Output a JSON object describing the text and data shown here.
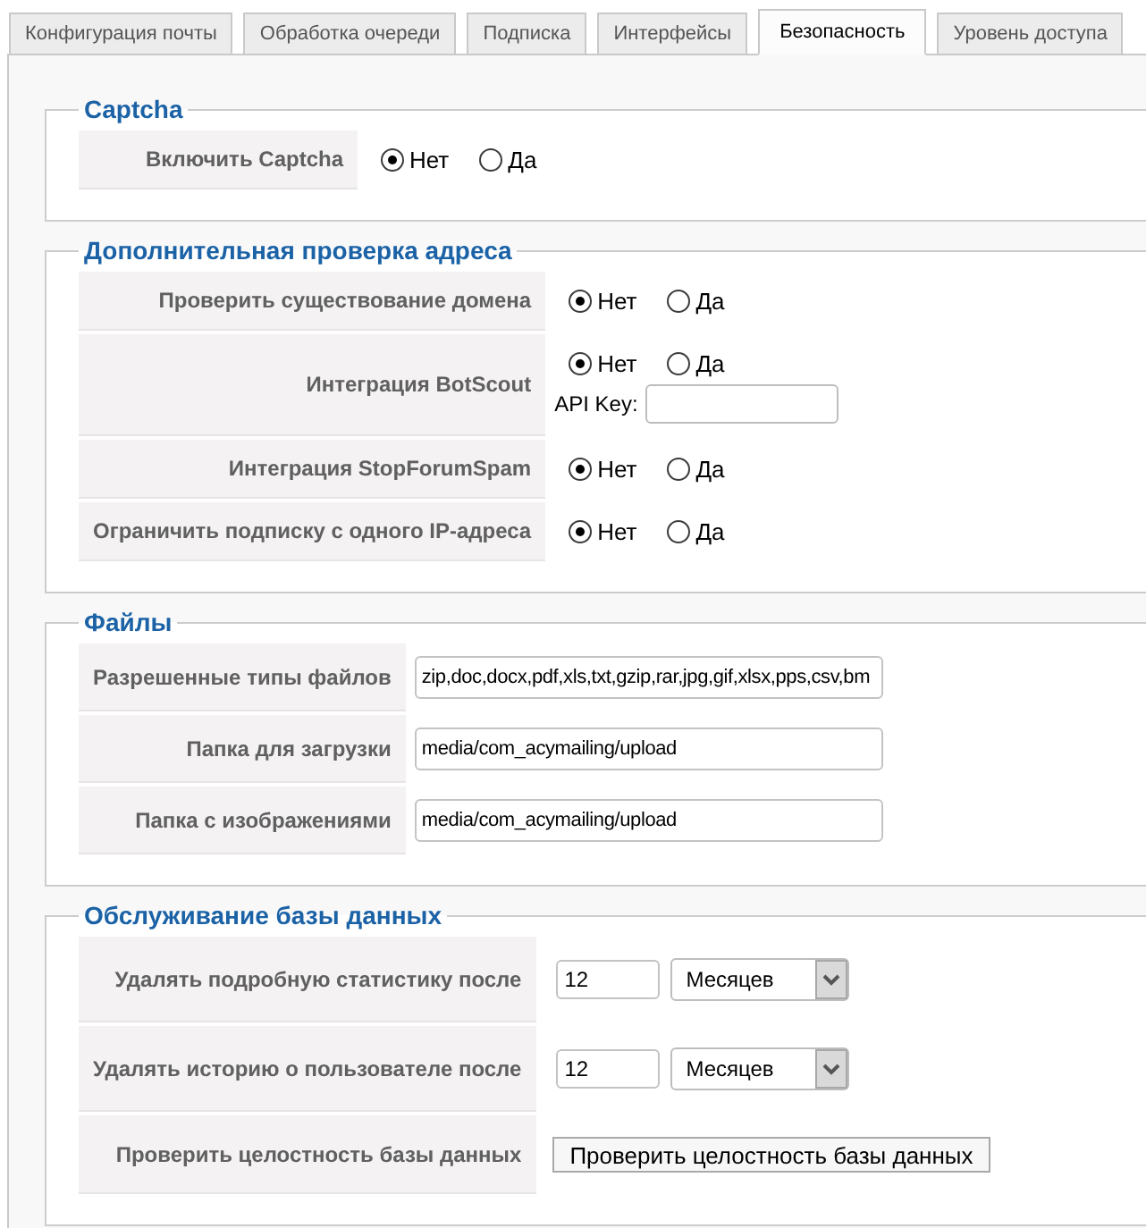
{
  "tabs": [
    {
      "label": "Конфигурация почты",
      "selected": false
    },
    {
      "label": "Обработка очереди",
      "selected": false
    },
    {
      "label": "Подписка",
      "selected": false
    },
    {
      "label": "Интерфейсы",
      "selected": false
    },
    {
      "label": "Безопасность",
      "selected": true
    },
    {
      "label": "Уровень доступа",
      "selected": false
    }
  ],
  "sections": [
    {
      "legend": "Captcha",
      "rows": [
        {
          "label": "Включить Captcha",
          "controls": [
            {
              "kind": "radio",
              "options": [
                {
                  "label": "Нет",
                  "selected": true
                },
                {
                  "label": "Да",
                  "selected": false
                }
              ]
            }
          ]
        }
      ]
    },
    {
      "legend": "Дополнительная проверка адреса",
      "rows": [
        {
          "label": "Проверить существование домена",
          "controls": [
            {
              "kind": "radio",
              "options": [
                {
                  "label": "Нет",
                  "selected": true
                },
                {
                  "label": "Да",
                  "selected": false
                }
              ]
            }
          ]
        },
        {
          "label": "Интеграция BotScout",
          "controls": [
            {
              "kind": "radio",
              "options": [
                {
                  "label": "Нет",
                  "selected": true
                },
                {
                  "label": "Да",
                  "selected": false
                }
              ]
            },
            {
              "kind": "field",
              "label": "API Key:"
            }
          ]
        },
        {
          "label": "Интеграция StopForumSpam",
          "controls": [
            {
              "kind": "radio",
              "options": [
                {
                  "label": "Нет",
                  "selected": true
                },
                {
                  "label": "Да",
                  "selected": false
                }
              ]
            }
          ]
        },
        {
          "label": "Ограничить подписку с одного IP-адреса",
          "controls": [
            {
              "kind": "radio",
              "options": [
                {
                  "label": "Нет",
                  "selected": true
                },
                {
                  "label": "Да",
                  "selected": false
                }
              ]
            }
          ]
        }
      ]
    },
    {
      "legend": "Файлы",
      "rows": [
        {
          "label": "Разрешенные типы файлов",
          "controls": [
            {
              "kind": "text",
              "value": "zip,doc,docx,pdf,xls,txt,gzip,rar,jpg,gif,xlsx,pps,csv,bm"
            }
          ]
        },
        {
          "label": "Папка для загрузки",
          "controls": [
            {
              "kind": "text",
              "value": "media/com_acymailing/upload"
            }
          ]
        },
        {
          "label": "Папка с изображениями",
          "controls": [
            {
              "kind": "text",
              "value": "media/com_acymailing/upload"
            }
          ]
        }
      ]
    },
    {
      "legend": "Обслуживание базы данных",
      "rows": [
        {
          "label": "Удалять подробную статистику после",
          "controls": [
            {
              "kind": "number",
              "value": "12"
            },
            {
              "kind": "select",
              "value": "Месяцев"
            }
          ]
        },
        {
          "label": "Удалять историю о пользователе после",
          "controls": [
            {
              "kind": "number",
              "value": "12"
            },
            {
              "kind": "select",
              "value": "Месяцев"
            }
          ]
        },
        {
          "label": "Проверить целостность базы данных",
          "controls": [
            {
              "kind": "button",
              "label": "Проверить целостность базы данных"
            }
          ]
        }
      ]
    }
  ]
}
